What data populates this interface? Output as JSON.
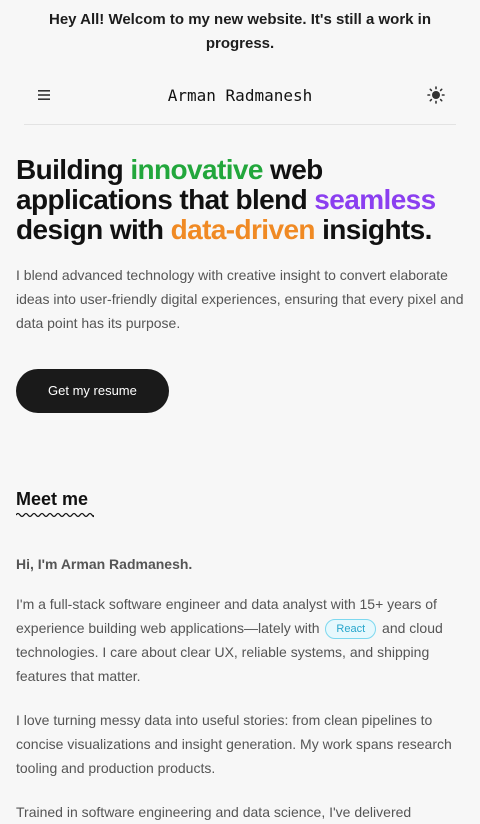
{
  "banner": {
    "text": "Hey All! Welcom to my new website. It's still a work in progress."
  },
  "header": {
    "menu_icon": "menu-icon",
    "brand": "Arman Radmanesh",
    "theme_icon": "sun-icon"
  },
  "hero": {
    "t1": "Building ",
    "t2": "innovative",
    "t3": " web applications that blend ",
    "t4": "seamless",
    "t5": " design with ",
    "t6": "data-driven",
    "t7": " insights.",
    "description": "I blend advanced technology with creative insight to convert elaborate ideas into user-friendly digital experiences, ensuring that every pixel and data point has its purpose.",
    "cta_label": "Get my resume"
  },
  "colors": {
    "green": "#22a73c",
    "purple": "#8b3ff0",
    "orange": "#f08a24",
    "button": "#1a1a1a"
  },
  "about": {
    "heading": "Meet me",
    "greeting": "Hi, I'm Arman Radmanesh.",
    "p1_before": "I'm a full-stack software engineer and data analyst with 15+ years of experience building web applications—lately with ",
    "p1_chip": "React",
    "p1_after": " and cloud technologies. I care about clear UX, reliable systems, and shipping features that matter.",
    "p2": "I love turning messy data into useful stories: from clean pipelines to concise visualizations and insight generation. My work spans research tooling and production products.",
    "p3": "Trained in software engineering and data science, I've delivered"
  }
}
